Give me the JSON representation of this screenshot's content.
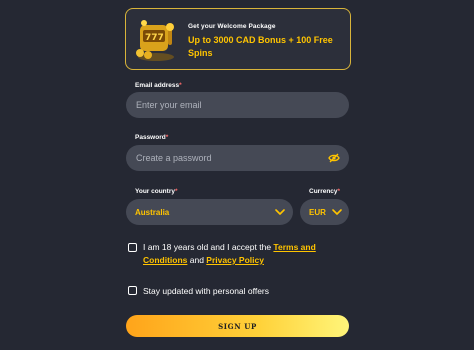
{
  "promo": {
    "subtitle": "Get your Welcome Package",
    "title": "Up to 3000 CAD Bonus + 100 Free Spins"
  },
  "email": {
    "label": "Email address",
    "required_mark": "*",
    "placeholder": "Enter your email"
  },
  "password": {
    "label": "Password",
    "required_mark": "*",
    "placeholder": "Create a password",
    "toggle_icon": "eye-slash-icon"
  },
  "country": {
    "label": "Your country",
    "required_mark": "*",
    "value": "Australia"
  },
  "currency": {
    "label": "Currency",
    "required_mark": "*",
    "value": "EUR"
  },
  "age_consent": {
    "text_before": "I am 18 years old and I accept the ",
    "terms_link": "Terms and Conditions",
    "text_between": " and ",
    "privacy_link": "Privacy Policy"
  },
  "newsletter": {
    "text": "Stay updated with personal offers"
  },
  "submit": {
    "label": "SIGN UP"
  },
  "colors": {
    "accent": "#ffc400",
    "background": "#252833",
    "field": "#454955"
  }
}
